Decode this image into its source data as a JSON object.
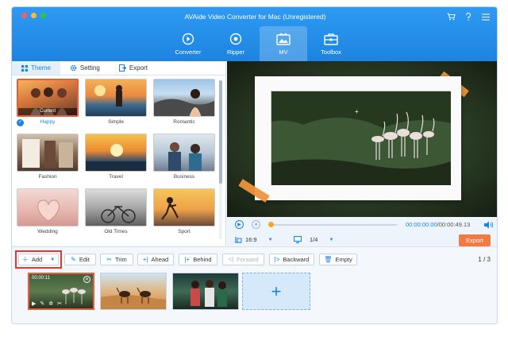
{
  "app": {
    "title": "AVAide Video Converter for Mac (Unregistered)"
  },
  "nav": {
    "items": [
      {
        "label": "Converter",
        "icon": "converter-icon"
      },
      {
        "label": "Ripper",
        "icon": "ripper-icon"
      },
      {
        "label": "MV",
        "icon": "mv-icon",
        "active": true
      },
      {
        "label": "Toolbox",
        "icon": "toolbox-icon"
      }
    ]
  },
  "panel": {
    "tabs": [
      {
        "label": "Theme",
        "icon": "grid-icon",
        "active": true
      },
      {
        "label": "Setting",
        "icon": "gear-icon"
      },
      {
        "label": "Export",
        "icon": "export-icon"
      }
    ],
    "themes": [
      {
        "label": "Happy",
        "caption": "Current",
        "selected": true
      },
      {
        "label": "Simple"
      },
      {
        "label": "Romantic"
      },
      {
        "label": "Fashion"
      },
      {
        "label": "Travel"
      },
      {
        "label": "Business"
      },
      {
        "label": "Wedding"
      },
      {
        "label": "Old Times"
      },
      {
        "label": "Sport"
      }
    ]
  },
  "player": {
    "current_time": "00:00:00.00",
    "total_time": "/00:00:49.13",
    "aspect_ratio": "16:9",
    "split": "1/4",
    "export_label": "Export",
    "progress": 0
  },
  "toolbar": {
    "add": "Add",
    "edit": "Edit",
    "trim": "Trim",
    "ahead": "Ahead",
    "behind": "Behind",
    "forward": "Forward",
    "backward": "Backward",
    "empty": "Empty",
    "page": "1 / 3"
  },
  "timeline": {
    "clips": [
      {
        "time": "00:00:11",
        "active": true
      },
      {
        "time": ""
      },
      {
        "time": ""
      }
    ]
  },
  "colors": {
    "accent": "#1c84e0",
    "export": "#f17a45",
    "highlight": "#e03a2f"
  }
}
